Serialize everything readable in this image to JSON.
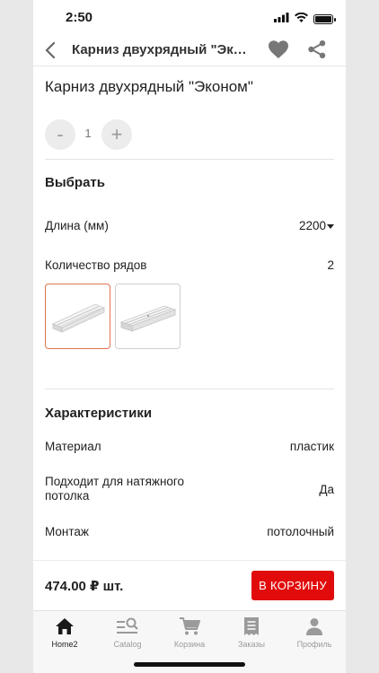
{
  "status": {
    "time": "2:50"
  },
  "nav": {
    "title": "Карниз двухрядный \"Эконом\""
  },
  "product": {
    "title": "Карниз двухрядный \"Эконом\""
  },
  "quantity": {
    "minus": "-",
    "value": "1",
    "plus": "+"
  },
  "select": {
    "title": "Выбрать",
    "length_label": "Длина (мм)",
    "length_value": "2200",
    "rows_label": "Количество рядов",
    "rows_value": "2",
    "selected_variant_index": 0
  },
  "specs": {
    "title": "Характеристики",
    "items": [
      {
        "label": "Материал",
        "value": "пластик"
      },
      {
        "label": "Подходит для натяжного потолка",
        "value": "Да"
      },
      {
        "label": "Монтаж",
        "value": "потолочный"
      }
    ]
  },
  "purchase": {
    "price": "474.00 ₽ шт.",
    "cart_label": "В КОРЗИНУ"
  },
  "tabbar": {
    "tabs": [
      {
        "label": "Home2",
        "icon": "home-icon",
        "active": true
      },
      {
        "label": "Catalog",
        "icon": "catalog-search-icon",
        "active": false
      },
      {
        "label": "Корзина",
        "icon": "cart-icon",
        "active": false
      },
      {
        "label": "Заказы",
        "icon": "receipt-icon",
        "active": false
      },
      {
        "label": "Профиль",
        "icon": "profile-icon",
        "active": false
      }
    ]
  },
  "colors": {
    "accent": "#e10b0b",
    "selected_border": "#e0734f",
    "muted": "#9a9a9a"
  }
}
